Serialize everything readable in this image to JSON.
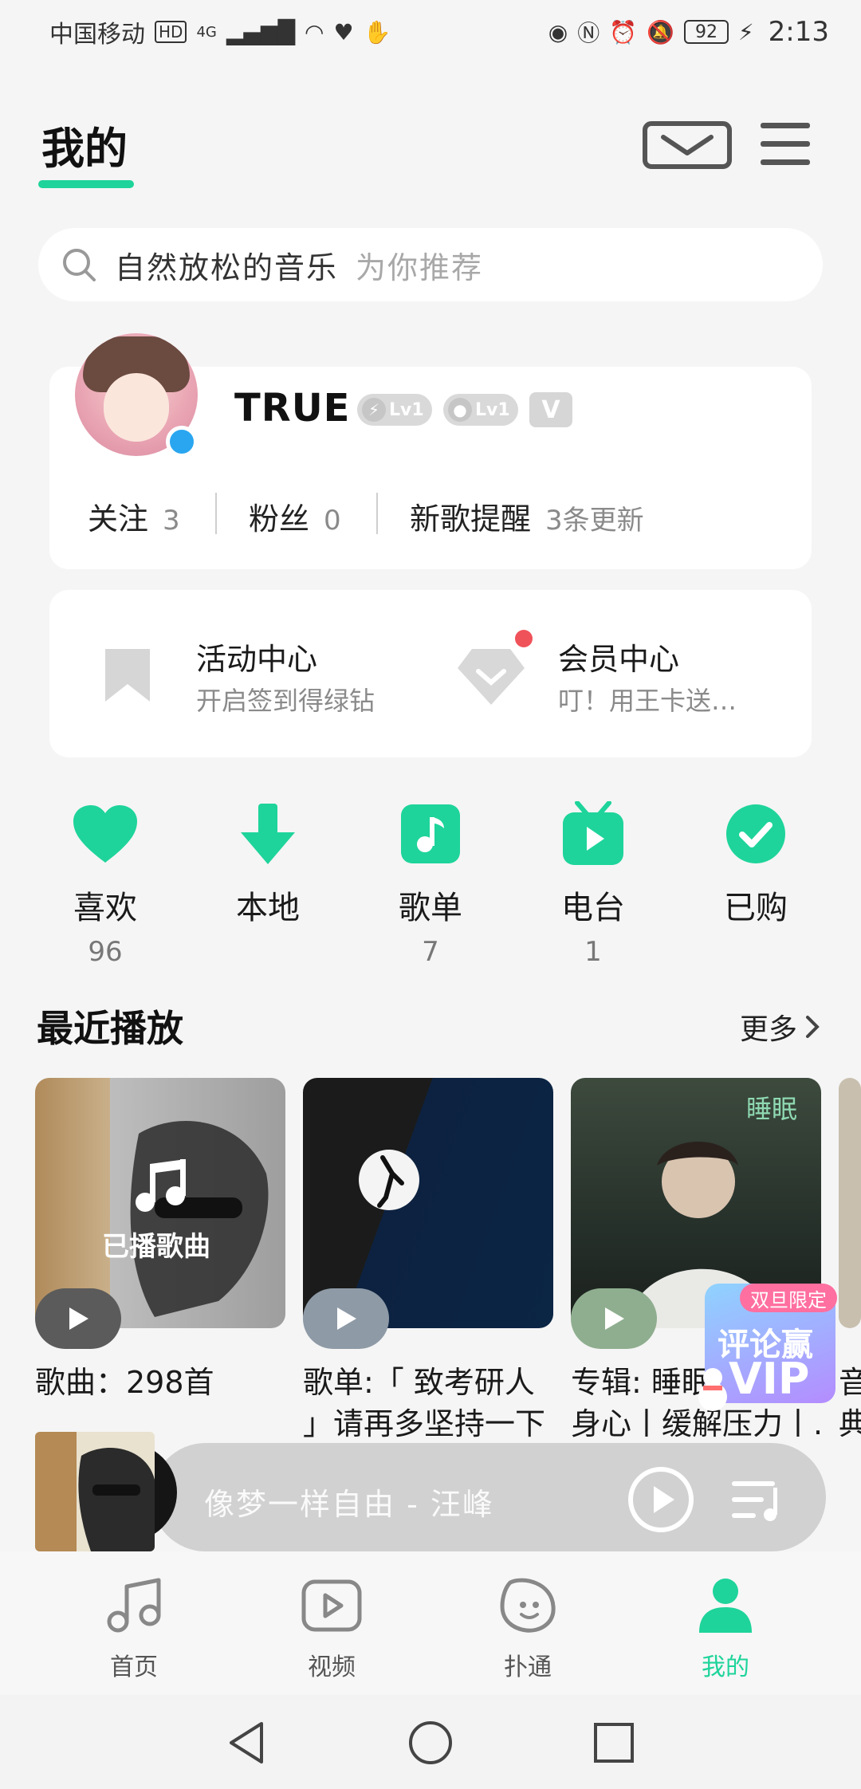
{
  "status_bar": {
    "carrier": "中国移动",
    "hd_badge": "HD",
    "network": "4G",
    "battery": "92",
    "time": "2:13"
  },
  "header": {
    "title": "我的"
  },
  "search": {
    "query": "自然放松的音乐",
    "hint": "为你推荐"
  },
  "profile": {
    "username": "TRUE",
    "badges": [
      {
        "icon": "lightning-icon",
        "label": "Lv1"
      },
      {
        "icon": "disc-icon",
        "label": "Lv1"
      }
    ],
    "vip_letter": "V",
    "stats": [
      {
        "label": "关注",
        "value": "3"
      },
      {
        "label": "粉丝",
        "value": "0"
      },
      {
        "label": "新歌提醒",
        "value": "3条更新"
      }
    ]
  },
  "activity": {
    "items": [
      {
        "title": "活动中心",
        "subtitle": "开启签到得绿钻",
        "icon": "bookmark-icon"
      },
      {
        "title": "会员中心",
        "subtitle": "叮！用王卡送…",
        "icon": "diamond-icon"
      }
    ]
  },
  "quick_actions": [
    {
      "label": "喜欢",
      "count": "96",
      "icon": "heart-icon"
    },
    {
      "label": "本地",
      "count": "",
      "icon": "download-icon"
    },
    {
      "label": "歌单",
      "count": "7",
      "icon": "music-note-icon"
    },
    {
      "label": "电台",
      "count": "1",
      "icon": "tv-radio-icon"
    },
    {
      "label": "已购",
      "count": "",
      "icon": "check-circle-icon"
    }
  ],
  "recent": {
    "title": "最近播放",
    "more": "更多",
    "tile1_overlay": "已播歌曲",
    "tile3_overlay": "睡眠",
    "tiles": [
      {
        "line1": "歌曲：298首",
        "line2": ""
      },
      {
        "line1": "歌单:「 致考研人",
        "line2": "」请再多坚持一下"
      },
      {
        "line1": "专辑: 睡眠",
        "line2": "身心丨缓解压力丨..."
      },
      {
        "line1": "音",
        "line2": "典"
      }
    ]
  },
  "vip_promo": {
    "tag": "双旦限定",
    "line1": "评论赢",
    "line2": "VIP"
  },
  "mini_player": {
    "title": "像梦一样自由 - 汪峰"
  },
  "bottom_nav": [
    {
      "label": "首页",
      "icon": "music-icon"
    },
    {
      "label": "视频",
      "icon": "video-play-icon"
    },
    {
      "label": "扑通",
      "icon": "chat-bubble-icon"
    },
    {
      "label": "我的",
      "icon": "person-icon"
    }
  ],
  "colors": {
    "accent": "#1ed49a",
    "background": "#f5f5f5",
    "card": "#ffffff"
  }
}
